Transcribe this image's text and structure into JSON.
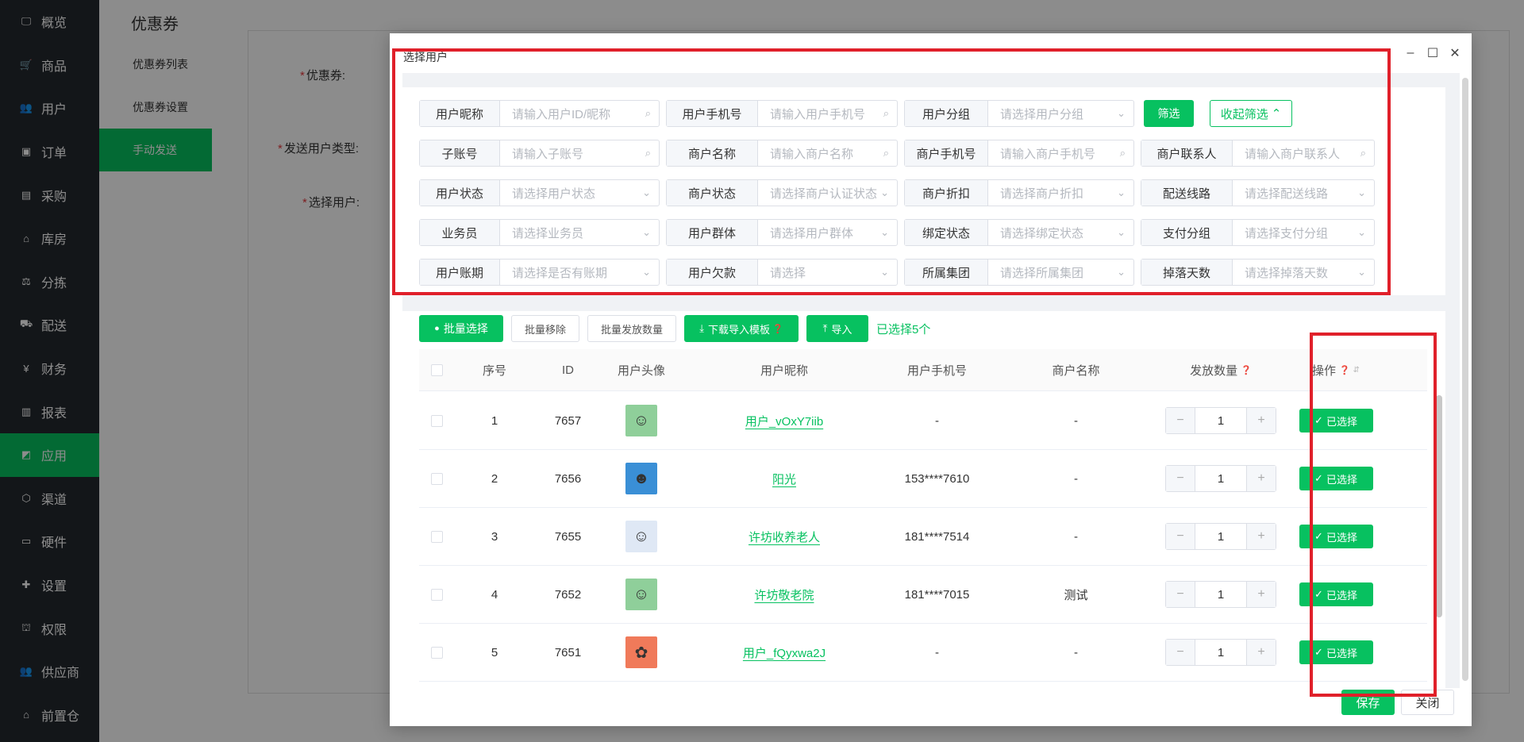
{
  "sidebar": {
    "items": [
      {
        "label": "概览",
        "icon": "monitor-icon",
        "glyph": "🖵"
      },
      {
        "label": "商品",
        "icon": "cart-icon",
        "glyph": "🛒"
      },
      {
        "label": "用户",
        "icon": "users-icon",
        "glyph": "👥"
      },
      {
        "label": "订单",
        "icon": "order-icon",
        "glyph": "▣"
      },
      {
        "label": "采购",
        "icon": "bus-icon",
        "glyph": "▤"
      },
      {
        "label": "库房",
        "icon": "home-icon",
        "glyph": "⌂"
      },
      {
        "label": "分拣",
        "icon": "scale-icon",
        "glyph": "⚖"
      },
      {
        "label": "配送",
        "icon": "truck-icon",
        "glyph": "⛟"
      },
      {
        "label": "财务",
        "icon": "yen-icon",
        "glyph": "¥"
      },
      {
        "label": "报表",
        "icon": "chart-icon",
        "glyph": "▥"
      },
      {
        "label": "应用",
        "icon": "apps-icon",
        "glyph": "◩"
      },
      {
        "label": "渠道",
        "icon": "cube-icon",
        "glyph": "⬡"
      },
      {
        "label": "硬件",
        "icon": "display-icon",
        "glyph": "▭"
      },
      {
        "label": "设置",
        "icon": "puzzle-icon",
        "glyph": "✚"
      },
      {
        "label": "权限",
        "icon": "bank-icon",
        "glyph": "⛫"
      },
      {
        "label": "供应商",
        "icon": "supplier-icon",
        "glyph": "👥"
      },
      {
        "label": "前置仓",
        "icon": "warehouse-icon",
        "glyph": "⌂"
      }
    ],
    "active_index": 10,
    "accent": "#07c160"
  },
  "subnav": {
    "title": "优惠券",
    "items": [
      "优惠券列表",
      "优惠券设置",
      "手动发送"
    ],
    "active_index": 2
  },
  "page_form": {
    "coupon_label": "优惠券:",
    "send_type_label": "发送用户类型:",
    "select_user_label": "选择用户:"
  },
  "modal": {
    "title": "选择用户",
    "filters": {
      "row1": [
        {
          "label": "用户昵称",
          "placeholder": "请输入用户ID/昵称",
          "suffix": "search"
        },
        {
          "label": "用户手机号",
          "placeholder": "请输入用户手机号",
          "suffix": "search"
        },
        {
          "label": "用户分组",
          "placeholder": "请选择用户分组",
          "suffix": "chevron"
        }
      ],
      "filter_btn": "筛选",
      "collapse_btn": "收起筛选",
      "row2": [
        {
          "label": "子账号",
          "placeholder": "请输入子账号",
          "suffix": "search"
        },
        {
          "label": "商户名称",
          "placeholder": "请输入商户名称",
          "suffix": "search"
        },
        {
          "label": "商户手机号",
          "placeholder": "请输入商户手机号",
          "suffix": "search"
        },
        {
          "label": "商户联系人",
          "placeholder": "请输入商户联系人",
          "suffix": "search"
        }
      ],
      "row3": [
        {
          "label": "用户状态",
          "placeholder": "请选择用户状态",
          "suffix": "chevron"
        },
        {
          "label": "商户状态",
          "placeholder": "请选择商户认证状态",
          "suffix": "chevron"
        },
        {
          "label": "商户折扣",
          "placeholder": "请选择商户折扣",
          "suffix": "chevron"
        },
        {
          "label": "配送线路",
          "placeholder": "请选择配送线路",
          "suffix": "chevron"
        }
      ],
      "row4": [
        {
          "label": "业务员",
          "placeholder": "请选择业务员",
          "suffix": "chevron"
        },
        {
          "label": "用户群体",
          "placeholder": "请选择用户群体",
          "suffix": "chevron"
        },
        {
          "label": "绑定状态",
          "placeholder": "请选择绑定状态",
          "suffix": "chevron"
        },
        {
          "label": "支付分组",
          "placeholder": "请选择支付分组",
          "suffix": "chevron"
        }
      ],
      "row5": [
        {
          "label": "用户账期",
          "placeholder": "请选择是否有账期",
          "suffix": "chevron"
        },
        {
          "label": "用户欠款",
          "placeholder": "请选择",
          "suffix": "chevron"
        },
        {
          "label": "所属集团",
          "placeholder": "请选择所属集团",
          "suffix": "chevron"
        },
        {
          "label": "掉落天数",
          "placeholder": "请选择掉落天数",
          "suffix": "chevron"
        }
      ]
    },
    "toolbar": {
      "batch_select": "批量选择",
      "batch_remove": "批量移除",
      "batch_qty": "批量发放数量",
      "download_template": "下载导入模板",
      "import": "导入",
      "selected_count": "已选择5个"
    },
    "table": {
      "headers": [
        "序号",
        "ID",
        "用户头像",
        "用户昵称",
        "用户手机号",
        "商户名称",
        "发放数量",
        "操作"
      ],
      "rows": [
        {
          "index": "1",
          "id": "7657",
          "nickname": "用户_vOxY7iib",
          "phone": "-",
          "merchant": "-",
          "qty": "1",
          "action": "已选择",
          "avatar_bg": "#8fcf9a",
          "avatar_glyph": "☺"
        },
        {
          "index": "2",
          "id": "7656",
          "nickname": "阳光",
          "phone": "153****7610",
          "merchant": "-",
          "qty": "1",
          "action": "已选择",
          "avatar_bg": "#3a8fd6",
          "avatar_glyph": "☻"
        },
        {
          "index": "3",
          "id": "7655",
          "nickname": "许坊收养老人",
          "phone": "181****7514",
          "merchant": "-",
          "qty": "1",
          "action": "已选择",
          "avatar_bg": "#dfe8f5",
          "avatar_glyph": "☺"
        },
        {
          "index": "4",
          "id": "7652",
          "nickname": "许坊敬老院",
          "phone": "181****7015",
          "merchant": "测试",
          "qty": "1",
          "action": "已选择",
          "avatar_bg": "#8fcf9a",
          "avatar_glyph": "☺"
        },
        {
          "index": "5",
          "id": "7651",
          "nickname": "用户_fQyxwa2J",
          "phone": "-",
          "merchant": "-",
          "qty": "1",
          "action": "已选择",
          "avatar_bg": "#f07a5a",
          "avatar_glyph": "✿"
        }
      ]
    },
    "footer": {
      "save": "保存",
      "close": "关闭"
    }
  }
}
